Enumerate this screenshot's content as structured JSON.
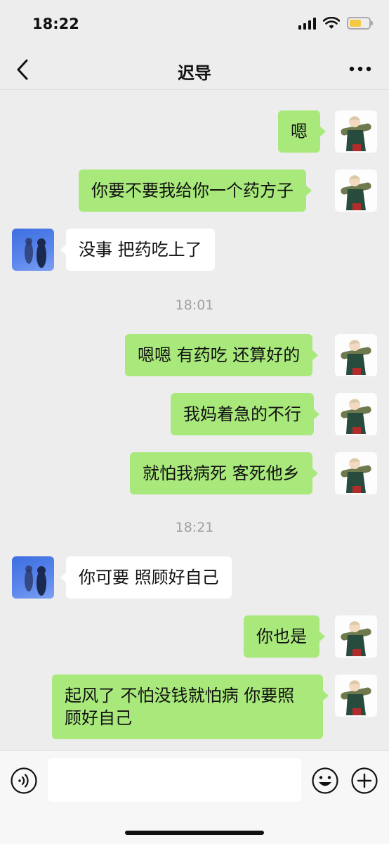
{
  "status_bar": {
    "time": "18:22",
    "battery_level": 0.6,
    "signal_bars": 4
  },
  "header": {
    "title": "迟导",
    "back_icon": "chevron-left-icon",
    "more_icon": "more-icon"
  },
  "messages": [
    {
      "side": "self",
      "text": "嗯"
    },
    {
      "side": "self",
      "text": "你要不要我给你一个药方子"
    },
    {
      "side": "other",
      "text": "没事 把药吃上了"
    },
    {
      "type": "time",
      "text": "18:01"
    },
    {
      "side": "self",
      "text": "嗯嗯 有药吃 还算好的"
    },
    {
      "side": "self",
      "text": "我妈着急的不行"
    },
    {
      "side": "self",
      "text": "就怕我病死 客死他乡"
    },
    {
      "type": "time",
      "text": "18:21"
    },
    {
      "side": "other",
      "text": "你可要 照顾好自己"
    },
    {
      "side": "self",
      "text": "你也是"
    },
    {
      "side": "self",
      "text": "起风了 不怕没钱就怕病 你要照顾好自己"
    }
  ],
  "input_bar": {
    "value": "",
    "voice_icon": "voice-icon",
    "emoji_icon": "emoji-icon",
    "plus_icon": "plus-icon"
  },
  "colors": {
    "self_bubble": "#a9e97c",
    "other_bubble": "#ffffff",
    "background": "#ededed"
  }
}
